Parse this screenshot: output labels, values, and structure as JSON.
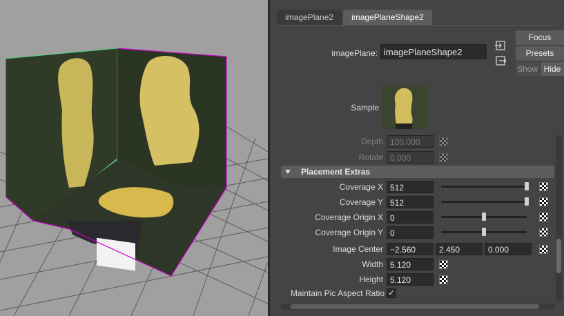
{
  "tabs": [
    {
      "label": "imagePlane2"
    },
    {
      "label": "imagePlaneShape2"
    }
  ],
  "header": {
    "image_plane_label": "imagePlane:",
    "image_plane_value": "imagePlaneShape2",
    "focus": "Focus",
    "presets": "Presets",
    "show": "Show",
    "hide": "Hide"
  },
  "sample": {
    "label": "Sample"
  },
  "fields": {
    "depth": {
      "label": "Depth",
      "value": "100.000"
    },
    "rotate": {
      "label": "Rotate",
      "value": "0.000"
    }
  },
  "section": {
    "title": "Placement Extras"
  },
  "placement": {
    "coverage_x": {
      "label": "Coverage X",
      "value": "512",
      "slider": 1.0
    },
    "coverage_y": {
      "label": "Coverage Y",
      "value": "512",
      "slider": 1.0
    },
    "coverage_origin_x": {
      "label": "Coverage Origin X",
      "value": "0",
      "slider": 0.5
    },
    "coverage_origin_y": {
      "label": "Coverage Origin Y",
      "value": "0",
      "slider": 0.5
    },
    "image_center": {
      "label": "Image Center",
      "x": "−2.560",
      "y": "2.450",
      "z": "0.000"
    },
    "width": {
      "label": "Width",
      "value": "5.120"
    },
    "height": {
      "label": "Height",
      "value": "5.120"
    },
    "maintain_aspect": {
      "label": "Maintain Pic Aspect Ratio",
      "checked": "✓"
    }
  },
  "colors": {
    "panel_bg": "#444444",
    "viewport_bg": "#a0a0a0",
    "selection_outline": "#d000d0",
    "plane_top_edge": "#40d080"
  }
}
